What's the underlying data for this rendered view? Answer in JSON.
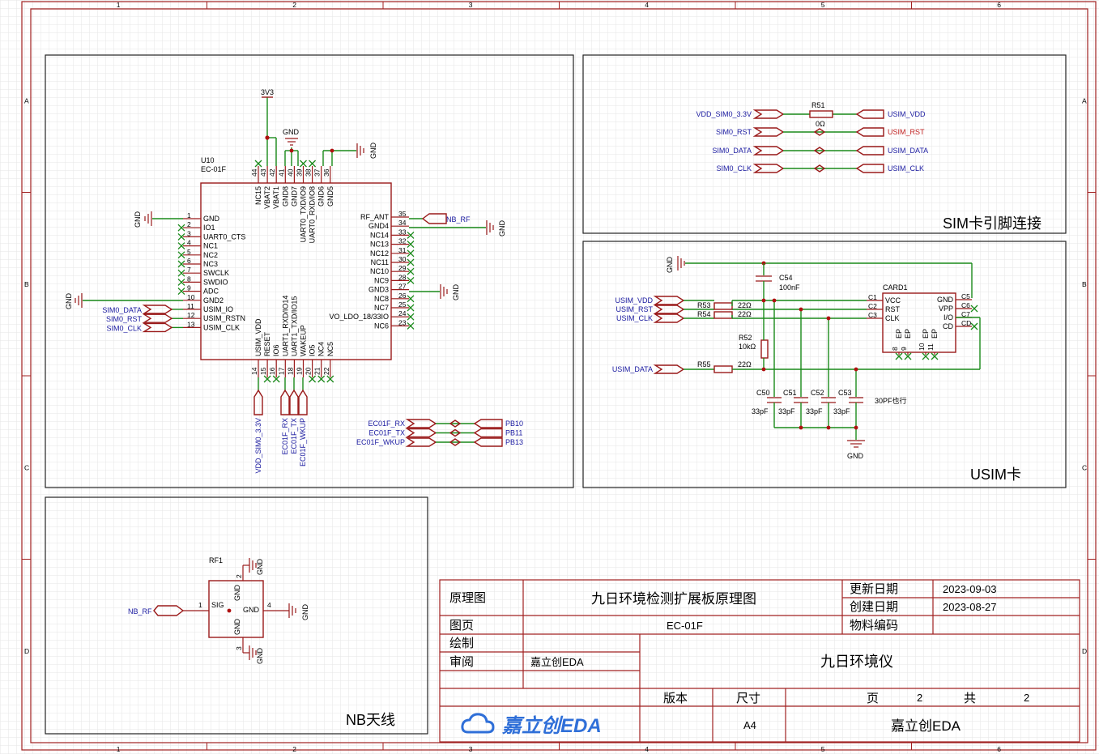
{
  "diagram": {
    "zone_numbers": [
      "1",
      "2",
      "3",
      "4",
      "5",
      "6"
    ],
    "zone_letters": [
      "A",
      "B",
      "C",
      "D"
    ],
    "panels": {
      "sim_pins": "SIM卡引脚连接",
      "usim": "USIM卡",
      "nb_antenna": "NB天线"
    },
    "ec01f": {
      "ref": "U10",
      "value": "EC-01F",
      "left_pins": [
        {
          "num": "1",
          "name": "GND"
        },
        {
          "num": "2",
          "name": "IO1"
        },
        {
          "num": "3",
          "name": "UART0_CTS"
        },
        {
          "num": "4",
          "name": "NC1"
        },
        {
          "num": "5",
          "name": "NC2"
        },
        {
          "num": "6",
          "name": "NC3"
        },
        {
          "num": "7",
          "name": "SWCLK"
        },
        {
          "num": "8",
          "name": "SWDIO"
        },
        {
          "num": "9",
          "name": "ADC"
        },
        {
          "num": "10",
          "name": "GND2"
        },
        {
          "num": "11",
          "name": "USIM_IO"
        },
        {
          "num": "12",
          "name": "USIM_RSTN"
        },
        {
          "num": "13",
          "name": "USIM_CLK"
        }
      ],
      "right_pins": [
        {
          "num": "35",
          "name": "RF_ANT"
        },
        {
          "num": "34",
          "name": "GND4"
        },
        {
          "num": "33",
          "name": "NC14"
        },
        {
          "num": "32",
          "name": "NC13"
        },
        {
          "num": "31",
          "name": "NC12"
        },
        {
          "num": "30",
          "name": "NC11"
        },
        {
          "num": "29",
          "name": "NC10"
        },
        {
          "num": "28",
          "name": "NC9"
        },
        {
          "num": "27",
          "name": "GND3"
        },
        {
          "num": "26",
          "name": "NC8"
        },
        {
          "num": "25",
          "name": "NC7"
        },
        {
          "num": "24",
          "name": "VO_LDO_18/33IO"
        },
        {
          "num": "23",
          "name": "NC6"
        }
      ],
      "top_pins": [
        {
          "num": "44",
          "name": "NC15"
        },
        {
          "num": "43",
          "name": "VBAT2"
        },
        {
          "num": "42",
          "name": "VBAT1"
        },
        {
          "num": "41",
          "name": "GND8"
        },
        {
          "num": "40",
          "name": "GND7"
        },
        {
          "num": "39",
          "name": "UART0_TXD/IO9"
        },
        {
          "num": "38",
          "name": "UART0_RXD/IO8"
        },
        {
          "num": "37",
          "name": "GND6"
        },
        {
          "num": "36",
          "name": "GND5"
        }
      ],
      "bottom_pins": [
        {
          "num": "14",
          "name": "USIM_VDD"
        },
        {
          "num": "15",
          "name": "RESET"
        },
        {
          "num": "16",
          "name": "IO6"
        },
        {
          "num": "17",
          "name": "UART1_RXD/IO14"
        },
        {
          "num": "18",
          "name": "UART1_TXD/IO15"
        },
        {
          "num": "19",
          "name": "WAKEUP"
        },
        {
          "num": "20",
          "name": "IO5"
        },
        {
          "num": "21",
          "name": "NC4"
        },
        {
          "num": "22",
          "name": "NC5"
        }
      ],
      "left_nets": [
        "SIM0_DATA",
        "SIM0_RST",
        "SIM0_CLK"
      ],
      "bottom_nets": [
        "VDD_SIM0_3.3V",
        "EC01F_RX",
        "EC01F_TX",
        "EC01F_WKUP"
      ],
      "power_3v3": "3V3",
      "gnd": "GND",
      "rf_net": "NB_RF"
    },
    "bridges": {
      "left": [
        "EC01F_RX",
        "EC01F_TX",
        "EC01F_WKUP"
      ],
      "right": [
        "PB10",
        "PB11",
        "PB13"
      ]
    },
    "sim_links": {
      "left": [
        "VDD_SIM0_3.3V",
        "SIM0_RST",
        "SIM0_DATA",
        "SIM0_CLK"
      ],
      "right": [
        "USIM_VDD",
        "USIM_RST",
        "USIM_DATA",
        "USIM_CLK"
      ],
      "resistor_ref": "R51",
      "resistor_value": "0Ω"
    },
    "usim": {
      "gnd": "GND",
      "c54": {
        "ref": "C54",
        "value": "100nF"
      },
      "card": {
        "ref": "CARD1",
        "left_pins": [
          {
            "num": "C1",
            "name": "VCC"
          },
          {
            "num": "C2",
            "name": "RST"
          },
          {
            "num": "C3",
            "name": "CLK"
          }
        ],
        "right_pins": [
          {
            "num": "C5",
            "name": "GND"
          },
          {
            "num": "C6",
            "name": "VPP"
          },
          {
            "num": "C7",
            "name": "I/O"
          },
          {
            "num": "CD",
            "name": "CD"
          }
        ],
        "bottom_pins": [
          {
            "num": "8",
            "name": "EP"
          },
          {
            "num": "9",
            "name": "EP"
          },
          {
            "num": "10",
            "name": "EP"
          },
          {
            "num": "11",
            "name": "EP"
          }
        ]
      },
      "inputs": [
        "USIM_VDD",
        "USIM_RST",
        "USIM_CLK",
        "USIM_DATA"
      ],
      "resistors": [
        {
          "ref": "R53",
          "value": "22Ω"
        },
        {
          "ref": "R54",
          "value": "22Ω"
        },
        {
          "ref": "R55",
          "value": "22Ω"
        },
        {
          "ref": "R52",
          "value": "10kΩ"
        }
      ],
      "caps": [
        {
          "ref": "C50",
          "value": "33pF"
        },
        {
          "ref": "C51",
          "value": "33pF"
        },
        {
          "ref": "C52",
          "value": "33pF"
        },
        {
          "ref": "C53",
          "value": "33pF"
        }
      ],
      "note": "30PF也行"
    },
    "antenna": {
      "ref": "RF1",
      "net": "NB_RF",
      "pins": [
        {
          "num": "1",
          "name": "SIG"
        },
        {
          "num": "2",
          "name": "GND"
        },
        {
          "num": "3",
          "name": "GND"
        },
        {
          "num": "4",
          "name": "GND"
        }
      ],
      "gnd": "GND"
    }
  },
  "title_block": {
    "label_schematic": "原理图",
    "title": "九日环境检测扩展板原理图",
    "label_update_date": "更新日期",
    "update_date": "2023-09-03",
    "label_create_date": "创建日期",
    "create_date": "2023-08-27",
    "label_page": "图页",
    "page_name": "EC-01F",
    "label_material_code": "物料编码",
    "label_drawn": "绘制",
    "label_reviewed": "审阅",
    "reviewer": "嘉立创EDA",
    "company": "九日环境仪",
    "label_version": "版本",
    "label_size": "尺寸",
    "label_page_num": "页",
    "page_num": "2",
    "label_total": "共",
    "total": "2",
    "logo": "嘉立创EDA",
    "size": "A4",
    "footer": "嘉立创EDA",
    "accent_color": "#2f6fd8"
  }
}
